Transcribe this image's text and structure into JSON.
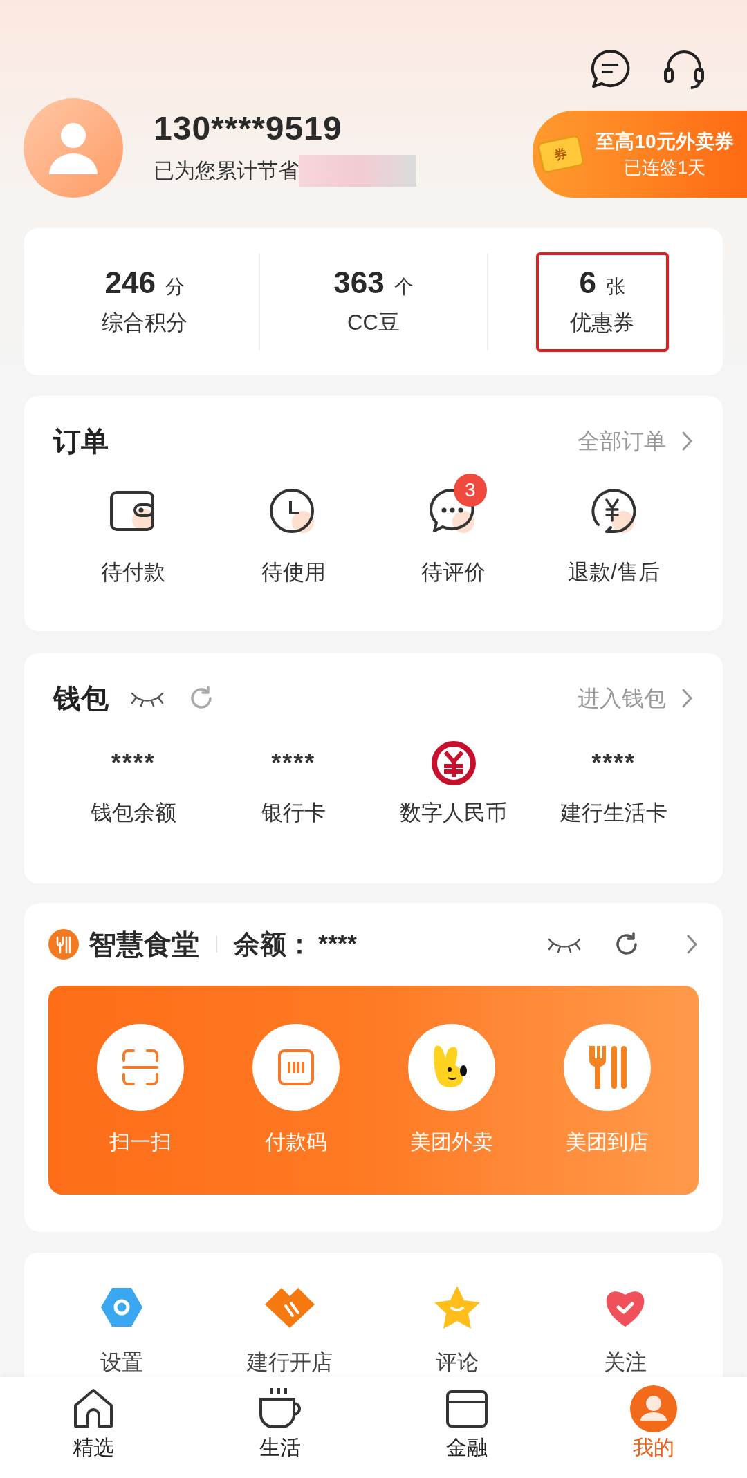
{
  "header": {
    "phone": "130****9519",
    "savings_label": "已为您累计节省"
  },
  "promo": {
    "title": "至高10元外卖券",
    "subtitle": "已连签1天",
    "tag": "券"
  },
  "stats": [
    {
      "value": "246",
      "unit": "分",
      "label": "综合积分",
      "highlighted": false
    },
    {
      "value": "363",
      "unit": "个",
      "label": "CC豆",
      "highlighted": false
    },
    {
      "value": "6",
      "unit": "张",
      "label": "优惠券",
      "highlighted": true
    }
  ],
  "orders": {
    "title": "订单",
    "link": "全部订单",
    "items": [
      {
        "label": "待付款"
      },
      {
        "label": "待使用"
      },
      {
        "label": "待评价",
        "badge": "3"
      },
      {
        "label": "退款/售后"
      }
    ]
  },
  "wallet": {
    "title": "钱包",
    "link": "进入钱包",
    "items": [
      {
        "kind": "masked",
        "value": "****",
        "label": "钱包余额"
      },
      {
        "kind": "masked",
        "value": "****",
        "label": "银行卡"
      },
      {
        "kind": "icon",
        "label": "数字人民币"
      },
      {
        "kind": "masked",
        "value": "****",
        "label": "建行生活卡"
      }
    ]
  },
  "canteen": {
    "title": "智慧食堂",
    "balance_label": "余额：",
    "balance_value": "****",
    "actions": [
      {
        "label": "扫一扫"
      },
      {
        "label": "付款码"
      },
      {
        "label": "美团外卖"
      },
      {
        "label": "美团到店"
      }
    ]
  },
  "tools": [
    {
      "label": "设置"
    },
    {
      "label": "建行开店"
    },
    {
      "label": "评论"
    },
    {
      "label": "关注"
    }
  ],
  "tabbar": [
    {
      "label": "精选",
      "selected": false
    },
    {
      "label": "生活",
      "selected": false
    },
    {
      "label": "金融",
      "selected": false
    },
    {
      "label": "我的",
      "selected": true
    }
  ]
}
